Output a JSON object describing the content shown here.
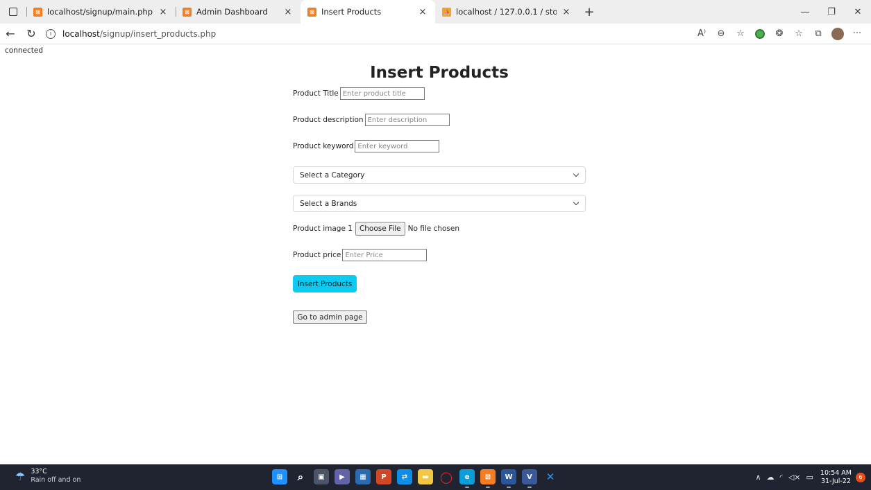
{
  "browser": {
    "tabs": [
      {
        "title": "localhost/signup/main.php?cate",
        "icon": "xampp-icon",
        "active": false
      },
      {
        "title": "Admin Dashboard",
        "icon": "xampp-icon",
        "active": false
      },
      {
        "title": "Insert Products",
        "icon": "xampp-icon",
        "active": true
      },
      {
        "title": "localhost / 127.0.0.1 / store / pro",
        "icon": "phpmyadmin-icon",
        "active": false
      }
    ],
    "new_tab": "+",
    "url_host": "localhost",
    "url_path": "/signup/insert_products.php"
  },
  "page": {
    "status": "connected",
    "title": "Insert Products",
    "fields": {
      "title": {
        "label": "Product Title",
        "placeholder": "Enter product title"
      },
      "description": {
        "label": "Product description",
        "placeholder": "Enter description"
      },
      "keyword": {
        "label": "Product keyword",
        "placeholder": "Enter keyword"
      },
      "image": {
        "label": "Product image 1",
        "button": "Choose File",
        "status": "No file chosen"
      },
      "price": {
        "label": "Product price",
        "placeholder": "Enter Price"
      }
    },
    "category_select": "Select a Category",
    "brand_select": "Select a Brands",
    "submit_label": "Insert Products",
    "admin_button": "Go to admin page"
  },
  "taskbar": {
    "temperature": "33°C",
    "weather": "Rain off and on",
    "time": "10:54 AM",
    "date": "31-Jul-22",
    "notifications": "6"
  },
  "colors": {
    "primary_button": "#0dcaf0",
    "taskbar": "#1f2430"
  }
}
